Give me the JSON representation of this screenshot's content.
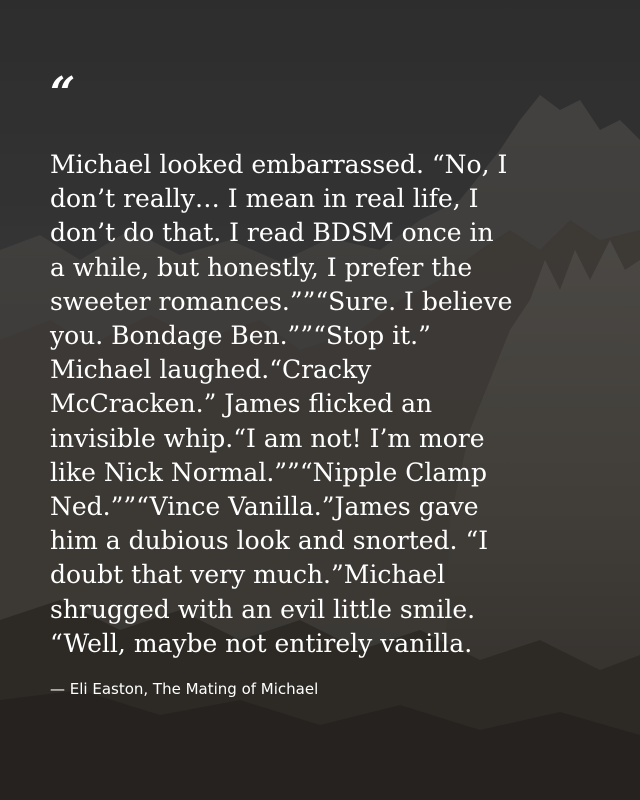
{
  "quote": {
    "mark": "“",
    "text": "Michael looked embarrassed. “No, I\ndon’t really… I mean in real life, I\ndon’t do that. I read BDSM once in\na while, but honestly, I prefer the\nsweeter romances.””“Sure. I believe\nyou. Bondage Ben.””“Stop it.”\nMichael laughed.“Cracky\nMcCracken.” James flicked an\ninvisible whip.“I am not! I’m more\nlike Nick Normal.””“Nipple Clamp\nNed.””“Vince Vanilla.”James gave\nhim a dubious look and snorted. “I\ndoubt that very much.”Michael\nshrugged with an evil little smile.\n“Well, maybe not entirely vanilla.",
    "attribution": "— Eli Easton, The Mating of Michael"
  },
  "colors": {
    "text": "#ffffff",
    "background": "#3f3d3a"
  }
}
